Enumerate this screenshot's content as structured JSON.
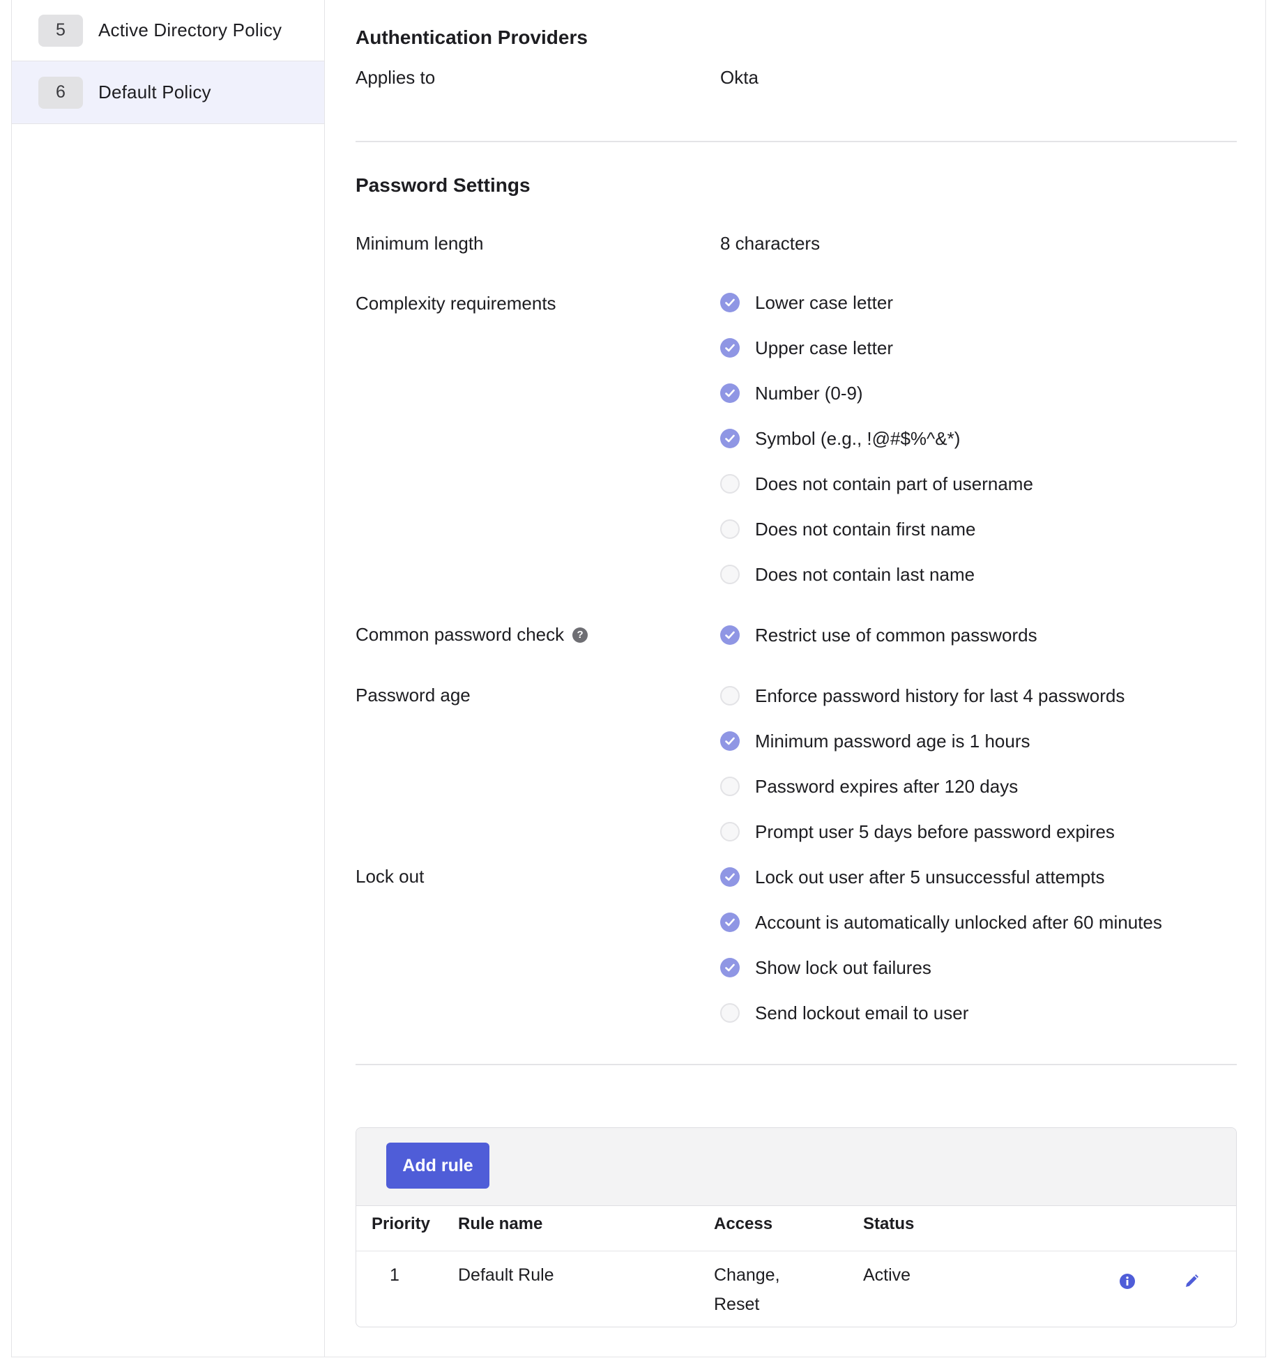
{
  "sidebar": {
    "items": [
      {
        "number": "5",
        "label": "Active Directory Policy",
        "selected": false
      },
      {
        "number": "6",
        "label": "Default Policy",
        "selected": true
      }
    ]
  },
  "auth": {
    "title": "Authentication Providers",
    "applies_label": "Applies to",
    "applies_value": "Okta"
  },
  "password": {
    "title": "Password Settings",
    "min_length_label": "Minimum length",
    "min_length_value": "8 characters",
    "complexity_label": "Complexity requirements",
    "complexity": [
      {
        "label": "Lower case letter",
        "checked": true
      },
      {
        "label": "Upper case letter",
        "checked": true
      },
      {
        "label": "Number (0-9)",
        "checked": true
      },
      {
        "label": "Symbol (e.g., !@#$%^&*)",
        "checked": true
      },
      {
        "label": "Does not contain part of username",
        "checked": false
      },
      {
        "label": "Does not contain first name",
        "checked": false
      },
      {
        "label": "Does not contain last name",
        "checked": false
      }
    ],
    "common_label": "Common password check",
    "common": [
      {
        "label": "Restrict use of common passwords",
        "checked": true
      }
    ],
    "age_label": "Password age",
    "age": [
      {
        "label": "Enforce password history for last 4 passwords",
        "checked": false
      },
      {
        "label": "Minimum password age is 1 hours",
        "checked": true
      },
      {
        "label": "Password expires after 120 days",
        "checked": false
      },
      {
        "label": "Prompt user 5 days before password expires",
        "checked": false
      }
    ],
    "lockout_label": "Lock out",
    "lockout": [
      {
        "label": "Lock out user after 5 unsuccessful attempts",
        "checked": true
      },
      {
        "label": "Account is automatically unlocked after 60 minutes",
        "checked": true
      },
      {
        "label": "Show lock out failures",
        "checked": true
      },
      {
        "label": "Send lockout email to user",
        "checked": false
      }
    ]
  },
  "rules": {
    "add_button": "Add rule",
    "columns": [
      "Priority",
      "Rule name",
      "Access",
      "Status"
    ],
    "rows": [
      {
        "priority": "1",
        "name": "Default Rule",
        "access_line1": "Change,",
        "access_line2": "Reset",
        "status": "Active"
      }
    ]
  },
  "icons": {
    "check": "check-icon",
    "help": "help-icon",
    "info": "info-icon",
    "edit": "pencil-icon"
  },
  "colors": {
    "accent": "#4f5dd8",
    "checked": "#8f96e4",
    "selected_bg": "#f0f1fc"
  }
}
